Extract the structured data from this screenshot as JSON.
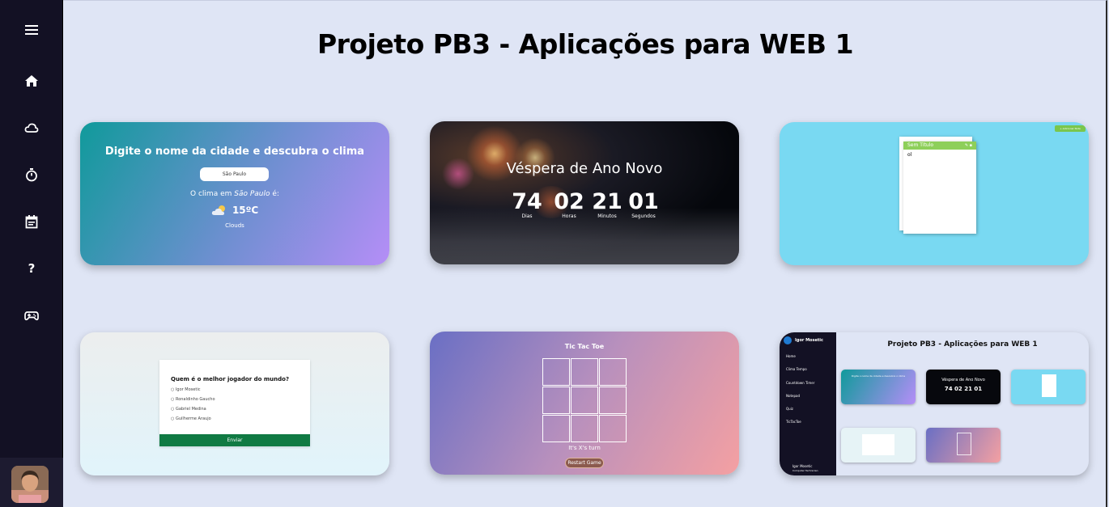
{
  "page_title": "Projeto PB3 - Aplicações para WEB 1",
  "sidebar": {
    "items": [
      {
        "icon": "menu-icon"
      },
      {
        "icon": "home-icon"
      },
      {
        "icon": "cloud-icon"
      },
      {
        "icon": "stopwatch-icon"
      },
      {
        "icon": "calendar-icon"
      },
      {
        "icon": "question-icon",
        "label": "?"
      },
      {
        "icon": "gamepad-icon"
      }
    ]
  },
  "weather": {
    "heading": "Digite o nome da cidade e descubra o clima",
    "input_value": "São Paulo",
    "line_prefix": "O clima em",
    "city": "São Paulo",
    "line_suffix": "é:",
    "temp": "15ºC",
    "desc": "Clouds"
  },
  "countdown": {
    "heading": "Véspera de Ano Novo",
    "units": [
      {
        "value": "74",
        "label": "Dias"
      },
      {
        "value": "02",
        "label": "Horas"
      },
      {
        "value": "21",
        "label": "Minutos"
      },
      {
        "value": "01",
        "label": "Segundos"
      }
    ]
  },
  "notes": {
    "button": "+ Adicionar Nota",
    "note_title": "Sem Título",
    "note_text": "ol"
  },
  "quiz": {
    "question": "Quem é o melhor jogador do mundo?",
    "options": [
      "Igor Mosetic",
      "Ronaldinho Gaucho",
      "Gabriel Medina",
      "Guilherme Araujo"
    ],
    "submit": "Enviar"
  },
  "tictactoe": {
    "title": "Tic Tac Toe",
    "turn": "It's X's turn",
    "restart": "Restart Game"
  },
  "preview": {
    "title": "Projeto PB3 - Aplicações para WEB 1",
    "user": "Igor Mosetic",
    "user_role": "Computer Technician",
    "menu": [
      "Home",
      "Clima Tempo",
      "Countdown Timer",
      "Notepad",
      "Quiz",
      "TicTacToe"
    ],
    "weather_heading": "Digite o nome da cidade e descubra o clima",
    "countdown_heading": "Véspera de Ano Novo",
    "countdown_values": "74 02 21 01"
  },
  "colors": {
    "sidebar_bg": "#131124",
    "page_bg": "#dfe5f5",
    "notes_bg": "#79d9f2",
    "quiz_button": "#107a43"
  }
}
